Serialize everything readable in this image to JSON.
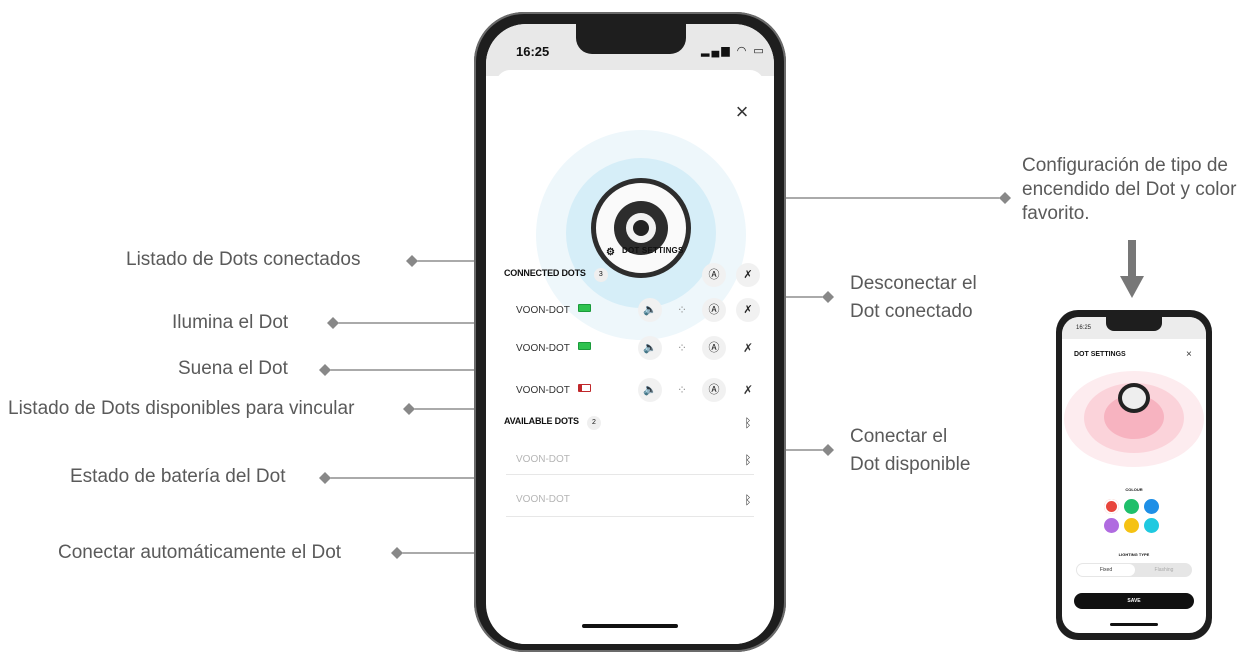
{
  "annotations": {
    "dot_settings_desc": "Configuración de tipo de encendido del Dot y color favorito.",
    "connected_list": "Listado de Dots conectados",
    "light_dot": "Ilumina el Dot",
    "sound_dot": "Suena el Dot",
    "available_list": "Listado de Dots disponibles para vincular",
    "battery": "Estado de batería del Dot",
    "auto_connect": "Conectar automáticamente el Dot",
    "disconnect_1": "Desconectar el",
    "disconnect_2": "Dot conectado",
    "connect_1": "Conectar el",
    "connect_2": "Dot disponible"
  },
  "phone": {
    "time": "16:25",
    "close": "×",
    "dot_settings": "DOT SETTINGS",
    "connected_title": "CONNECTED DOTS",
    "connected_count": "3",
    "available_title": "AVAILABLE DOTS",
    "available_count": "2",
    "connected": [
      {
        "name": "VOON-DOT",
        "battery": "full"
      },
      {
        "name": "VOON-DOT",
        "battery": "full"
      },
      {
        "name": "VOON-DOT",
        "battery": "low"
      }
    ],
    "available": [
      {
        "name": "VOON-DOT"
      },
      {
        "name": "VOON-DOT"
      }
    ],
    "icons": {
      "sound": "speaker-icon",
      "light": "light-icon",
      "auto": "auto-connect-icon",
      "bluetooth_off": "bluetooth-off-icon",
      "bluetooth": "bluetooth-icon"
    }
  },
  "preview_phone": {
    "time": "16:25",
    "title": "DOT SETTINGS",
    "close": "×",
    "colour_label": "COLOUR",
    "lighting_type_label": "LIGHTING TYPE",
    "fixed": "Fixed",
    "flashing": "Flashing",
    "save": "SAVE",
    "colors": [
      "#e8453c",
      "#1fbf6a",
      "#1e8fe6",
      "#b06be0",
      "#f5c213",
      "#1fc9e0"
    ]
  }
}
